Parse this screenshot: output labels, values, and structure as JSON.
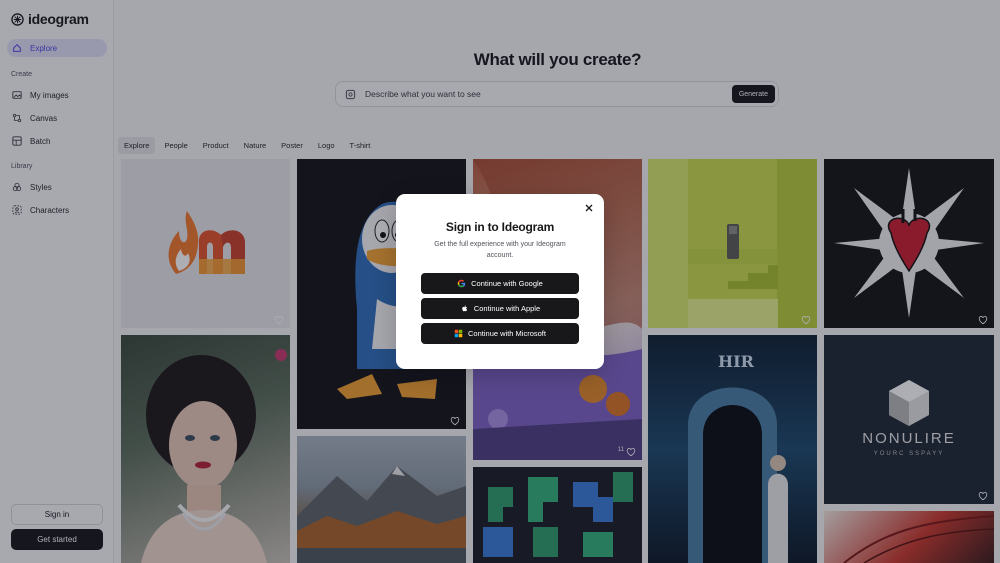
{
  "app": {
    "name": "ideogram"
  },
  "sidebar": {
    "explore_label": "Explore",
    "create_label": "Create",
    "create_items": [
      {
        "label": "My images",
        "icon": "images-icon"
      },
      {
        "label": "Canvas",
        "icon": "canvas-icon"
      },
      {
        "label": "Batch",
        "icon": "batch-icon"
      }
    ],
    "library_label": "Library",
    "library_items": [
      {
        "label": "Styles",
        "icon": "styles-icon"
      },
      {
        "label": "Characters",
        "icon": "characters-icon"
      }
    ],
    "signin_label": "Sign in",
    "getstarted_label": "Get started"
  },
  "main": {
    "headline": "What will you create?",
    "prompt": {
      "placeholder": "Describe what you want to see",
      "generate_label": "Generate"
    },
    "tabs": [
      "Explore",
      "People",
      "Product",
      "Nature",
      "Poster",
      "Logo",
      "T-shirt"
    ],
    "active_tab": "Explore",
    "gallery": {
      "card_logo_text": "NONULIRE",
      "card_logo_subtext": "YOURC SSPAYY",
      "card_poster_text": "HIR",
      "like_count": "11"
    }
  },
  "modal": {
    "title": "Sign in to Ideogram",
    "subtitle": "Get the full experience with your Ideogram account.",
    "google_label": "Continue with Google",
    "apple_label": "Continue with Apple",
    "microsoft_label": "Continue with Microsoft"
  },
  "colors": {
    "accent": "#4f46e5",
    "dark": "#18181b",
    "overlay": "rgba(20,20,40,0.35)"
  }
}
